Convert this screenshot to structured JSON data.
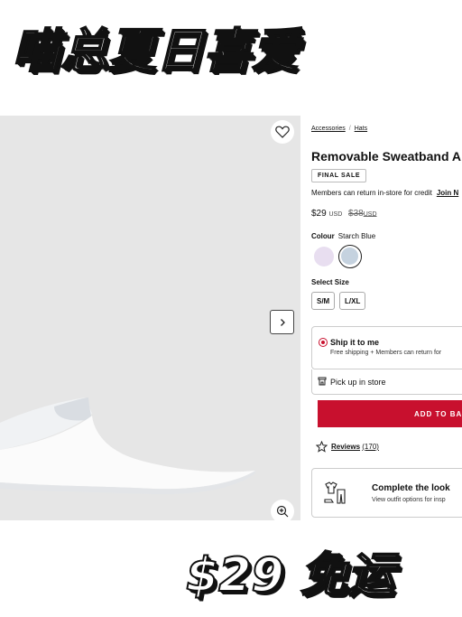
{
  "banner": {
    "headline": "喵总夏日喜爱",
    "promo": "$29 免运"
  },
  "product": {
    "breadcrumb": [
      "Accessories",
      "Hats"
    ],
    "breadcrumb_sep": "/",
    "title": "Removable Sweatband A",
    "badge": "FINAL SALE",
    "members_note": "Members can return in-store for credit",
    "members_link": "Join N",
    "price": "$29",
    "price_currency": "USD",
    "original_price": "$38",
    "original_currency": "USD",
    "colour_label": "Colour",
    "colour_value": "Starch Blue",
    "swatches": [
      {
        "name": "lilac",
        "color": "#e8def0"
      },
      {
        "name": "starch-blue",
        "color": "#c5d2df",
        "selected": true
      }
    ],
    "size_label": "Select Size",
    "sizes": [
      "S/M",
      "L/XL"
    ],
    "ship_title": "Ship it to me",
    "ship_sub": "Free shipping + Members can return for",
    "pickup_label": "Pick up in store",
    "add_to_bag": "ADD TO BAG",
    "reviews_label": "Reviews",
    "reviews_count": "(170)",
    "look_title": "Complete the look",
    "look_sub": "View outfit options for insp"
  },
  "icons": {
    "favorite": "heart-icon",
    "next": "chevron-right-icon",
    "zoom": "zoom-in-icon",
    "store": "store-icon",
    "star": "star-icon",
    "outfit": "outfit-icon"
  },
  "colors": {
    "accent": "#c8102e",
    "photo_bg": "#e6e6e6"
  }
}
